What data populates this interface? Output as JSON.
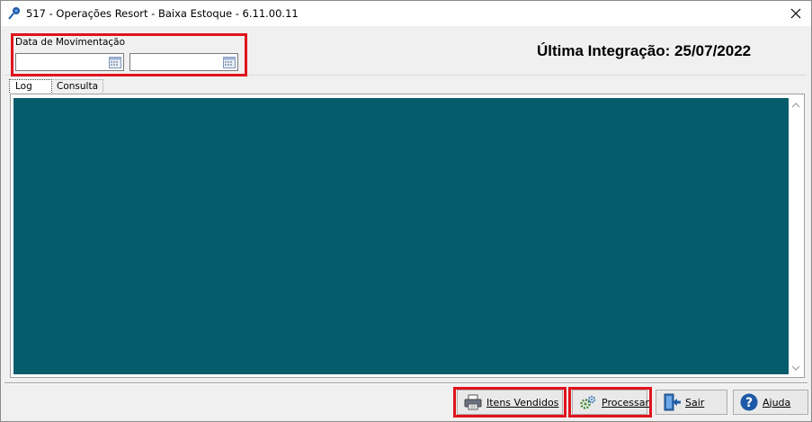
{
  "window": {
    "title": "517 - Operações Resort - Baixa Estoque - 6.11.00.11",
    "icon": "pin-icon",
    "close_icon": "close-icon"
  },
  "header": {
    "date_label": "Data de Movimentação",
    "date_from": {
      "value": "",
      "icon": "calendar-icon"
    },
    "date_to": {
      "value": "",
      "icon": "calendar-icon"
    },
    "integracao_text": "Última Integração: 25/07/2022"
  },
  "tabs": [
    {
      "label": "Log",
      "active": true
    },
    {
      "label": "Consulta",
      "active": false
    }
  ],
  "log": {
    "background_color": "#055c6b"
  },
  "buttons": [
    {
      "label": "Itens Vendidos",
      "icon": "printer-icon",
      "highlighted": true
    },
    {
      "label": "Processar",
      "icon": "gears-icon",
      "highlighted": true
    },
    {
      "label": "Sair",
      "icon": "exit-door-icon",
      "highlighted": false
    },
    {
      "label": "Ajuda",
      "icon": "help-icon",
      "highlighted": false
    }
  ],
  "colors": {
    "highlight": "#e0141e",
    "log_bg": "#055c6b",
    "accent_blue": "#1e5aa8"
  }
}
